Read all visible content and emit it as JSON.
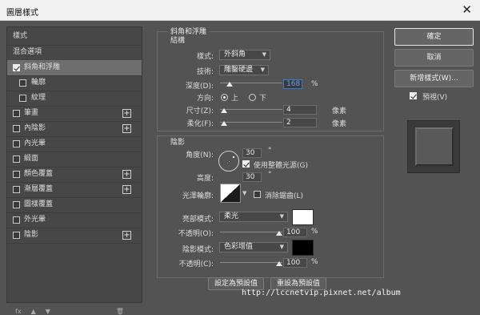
{
  "window": {
    "title": "圖層樣式",
    "close_glyph": "✕"
  },
  "sidebar": {
    "header": "樣式",
    "blend_options": "混合選項",
    "items": [
      {
        "label": "斜角和浮雕",
        "checked": true
      },
      {
        "label": "輪廓",
        "checked": false
      },
      {
        "label": "紋理",
        "checked": false
      },
      {
        "label": "筆畫",
        "checked": false
      },
      {
        "label": "內陰影",
        "checked": false
      },
      {
        "label": "內光暈",
        "checked": false
      },
      {
        "label": "緞面",
        "checked": false
      },
      {
        "label": "顏色覆蓋",
        "checked": false
      },
      {
        "label": "漸層覆蓋",
        "checked": false
      },
      {
        "label": "圖樣覆蓋",
        "checked": false
      },
      {
        "label": "外光暈",
        "checked": false
      },
      {
        "label": "陰影",
        "checked": false
      }
    ],
    "plus_glyph": "+",
    "footer": [
      "fx",
      "▲",
      "▼",
      "🗑"
    ]
  },
  "bevel": {
    "title": "斜角和浮雕",
    "structure": {
      "title": "結構",
      "style_label": "樣式:",
      "style_value": "外斜角",
      "technique_label": "技術:",
      "technique_value": "雕鑿硬邊",
      "depth_label": "深度(D):",
      "depth_value": "168",
      "depth_unit": "%",
      "direction_label": "方向:",
      "direction_up": "上",
      "direction_down": "下",
      "size_label": "尺寸(Z):",
      "size_value": "4",
      "size_unit": "像素",
      "soften_label": "柔化(F):",
      "soften_value": "2",
      "soften_unit": "像素"
    },
    "shading": {
      "title": "陰影",
      "angle_label": "角度(N):",
      "angle_value": "30",
      "degree": "°",
      "global_light": "使用整體光源(G)",
      "altitude_label": "高度:",
      "altitude_value": "30",
      "gloss_label": "光澤輪廓:",
      "antialias": "消除鋸齒(L)",
      "highlight_mode_label": "亮部模式:",
      "highlight_mode_value": "柔光",
      "highlight_color": "#ffffff",
      "hl_opacity_label": "不透明(O):",
      "hl_opacity_value": "100",
      "shadow_mode_label": "陰影模式:",
      "shadow_mode_value": "色彩增值",
      "shadow_color": "#000000",
      "sh_opacity_label": "不透明(C):",
      "sh_opacity_value": "100",
      "pct": "%"
    },
    "set_default": "設定為預設值",
    "reset_default": "重設為預設值"
  },
  "buttons": {
    "ok": "確定",
    "cancel": "取消",
    "new_style": "新增樣式(W)...",
    "preview": "預視(V)"
  },
  "watermark": "http://lccnetvip.pixnet.net/album"
}
